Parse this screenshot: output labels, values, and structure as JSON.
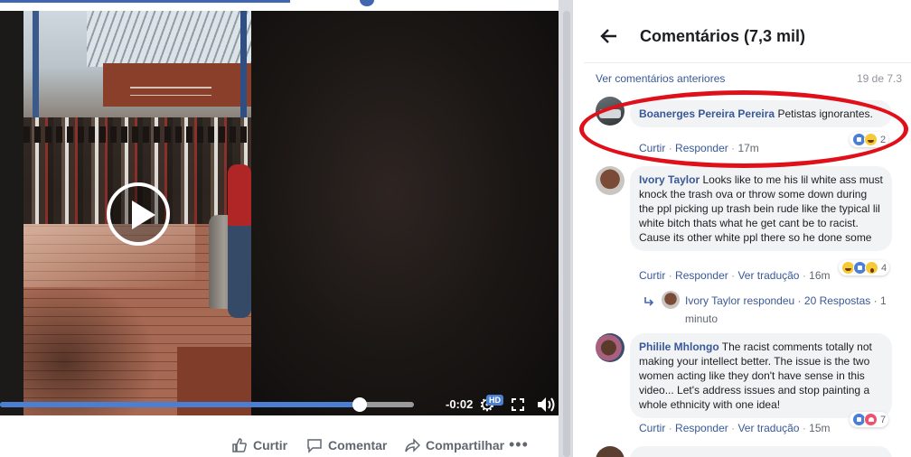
{
  "video": {
    "time_remaining": "-0:02",
    "quality_badge": "HD",
    "progress": 0.87,
    "topbar_progress": 0.52
  },
  "actions": {
    "like": "Curtir",
    "comment": "Comentar",
    "share": "Compartilhar",
    "more": "•••"
  },
  "comments_panel": {
    "title": "Comentários (7,3 mil)",
    "view_previous": "Ver comentários anteriores",
    "count": "19 de 7.3",
    "like_action": "Curtir",
    "reply_action": "Responder",
    "translate_action": "Ver tradução",
    "separator": "·"
  },
  "comments": [
    {
      "author": "Boanerges Pereira Pereira",
      "text": "Petistas ignorantes.",
      "time": "17m",
      "reactions": [
        "like",
        "haha"
      ],
      "reaction_count": "2"
    },
    {
      "author": "Ivory Taylor",
      "text": "Looks like to me his lil white ass must knock the trash ova or throw some down during the ppl picking up trash bein rude like the typical lil white bitch thats what he get cant be to racist. Cause its other white ppl there so he done some",
      "time": "16m",
      "reactions": [
        "haha",
        "like",
        "wow"
      ],
      "reaction_count": "4",
      "replies": {
        "author": "Ivory Taylor",
        "verb": "respondeu",
        "count": "20 Respostas",
        "age_a": "1",
        "age_b": "minuto"
      }
    },
    {
      "author": "Philile Mhlongo",
      "text": "The racist comments totally not making your intellect better. The issue is the two women acting like they don't have sense in this video... Let's address issues and stop painting a whole ethnicity with one idea!",
      "time": "15m",
      "reactions": [
        "like",
        "love"
      ],
      "reaction_count": "7"
    }
  ],
  "colors": {
    "brand": "#4267b2",
    "link": "#385898",
    "bubble": "#f2f3f5",
    "annotation": "#e0101a"
  }
}
